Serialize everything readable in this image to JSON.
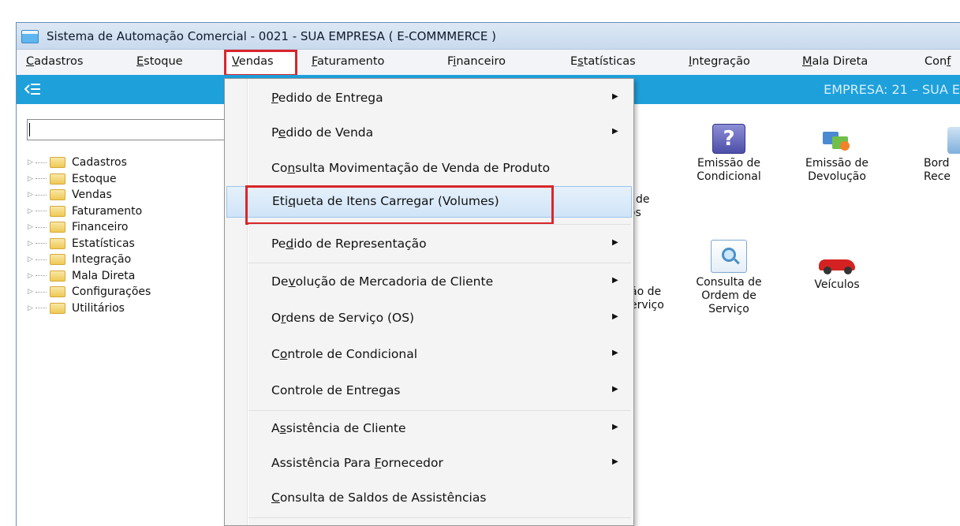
{
  "window": {
    "title": "Sistema de Automação Comercial - 0021 - SUA EMPRESA  ( E-COMMMERCE )"
  },
  "menubar": {
    "items": [
      {
        "pre": "",
        "ul": "C",
        "post": "adastros"
      },
      {
        "pre": "",
        "ul": "E",
        "post": "stoque"
      },
      {
        "pre": "",
        "ul": "V",
        "post": "endas"
      },
      {
        "pre": "",
        "ul": "F",
        "post": "aturamento"
      },
      {
        "pre": "F",
        "ul": "i",
        "post": "nanceiro"
      },
      {
        "pre": "E",
        "ul": "s",
        "post": "tatísticas"
      },
      {
        "pre": "",
        "ul": "I",
        "post": "ntegração"
      },
      {
        "pre": "",
        "ul": "M",
        "post": "ala Direta"
      },
      {
        "pre": "Con",
        "ul": "f",
        "post": ""
      }
    ]
  },
  "banner": {
    "empresa": "EMPRESA:  21  –  SUA E"
  },
  "sidebar": {
    "search_value": "",
    "tree": [
      "Cadastros",
      "Estoque",
      "Vendas",
      "Faturamento",
      "Financeiro",
      "Estatísticas",
      "Integração",
      "Mala Direta",
      "Configurações",
      "Utilitários"
    ]
  },
  "tiles": {
    "partial_1_l1": "o de",
    "partial_1_l2": "los",
    "emissao_condicional_l1": "Emissão de",
    "emissao_condicional_l2": "Condicional",
    "emissao_devolucao_l1": "Emissão de",
    "emissao_devolucao_l2": "Devolução",
    "bord_l1": "Bord",
    "bord_l2": "Rece",
    "partial_2_l1": "ão de",
    "partial_2_l2": "erviço",
    "consulta_os_l1": "Consulta de",
    "consulta_os_l2": "Ordem de",
    "consulta_os_l3": "Serviço",
    "veiculos": "Veículos",
    "q_icon_glyph": "?"
  },
  "dropdown": {
    "items": [
      {
        "pre": "",
        "ul": "P",
        "post": "edido de Entrega",
        "submenu": true
      },
      {
        "pre": "P",
        "ul": "e",
        "post": "dido de Venda",
        "submenu": true
      },
      {
        "pre": "Co",
        "ul": "n",
        "post": "sulta Movimentação de Venda de Produto",
        "submenu": false
      },
      {
        "pre": "Eti",
        "ul": "q",
        "post": "ueta de Itens Carregar (Volumes)",
        "submenu": false,
        "selected": true
      },
      {
        "pre": "Pe",
        "ul": "d",
        "post": "ido de Representação",
        "submenu": true
      },
      {
        "pre": "De",
        "ul": "v",
        "post": "olução de Mercadoria de Cliente",
        "submenu": true
      },
      {
        "pre": "O",
        "ul": "r",
        "post": "dens de Serviço (OS)",
        "submenu": true
      },
      {
        "pre": "C",
        "ul": "o",
        "post": "ntrole de Condicional",
        "submenu": true
      },
      {
        "pre": "Controle de Entre",
        "ul": "g",
        "post": "as",
        "submenu": true
      },
      {
        "pre": "A",
        "ul": "s",
        "post": "sistência de Cliente",
        "submenu": true
      },
      {
        "pre": "Assistência Para ",
        "ul": "F",
        "post": "ornecedor",
        "submenu": true
      },
      {
        "pre": "",
        "ul": "C",
        "post": "onsulta de Saldos de Assistências",
        "submenu": false
      }
    ]
  },
  "colors": {
    "banner": "#1ea0db",
    "highlight_border": "#d9262c"
  }
}
